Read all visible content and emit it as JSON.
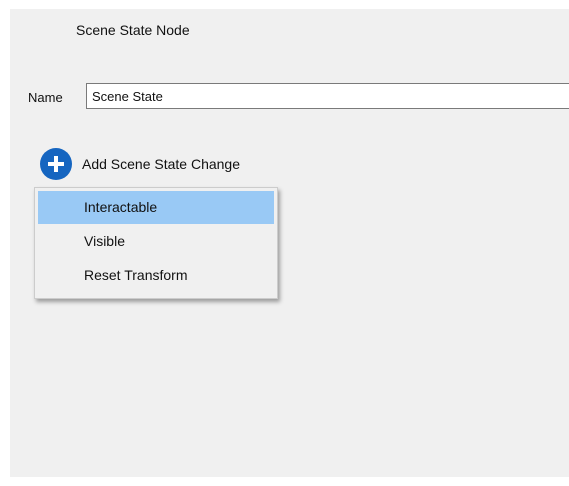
{
  "panel": {
    "title": "Scene State Node"
  },
  "name_field": {
    "label": "Name",
    "value": "Scene State"
  },
  "add_button": {
    "label": "Add Scene State Change",
    "icon": "plus-circle-icon",
    "icon_color": "#1565c0"
  },
  "menu": {
    "items": [
      {
        "label": "Interactable",
        "highlighted": true
      },
      {
        "label": "Visible",
        "highlighted": false
      },
      {
        "label": "Reset Transform",
        "highlighted": false
      }
    ],
    "highlight_color": "#99c9f5"
  }
}
